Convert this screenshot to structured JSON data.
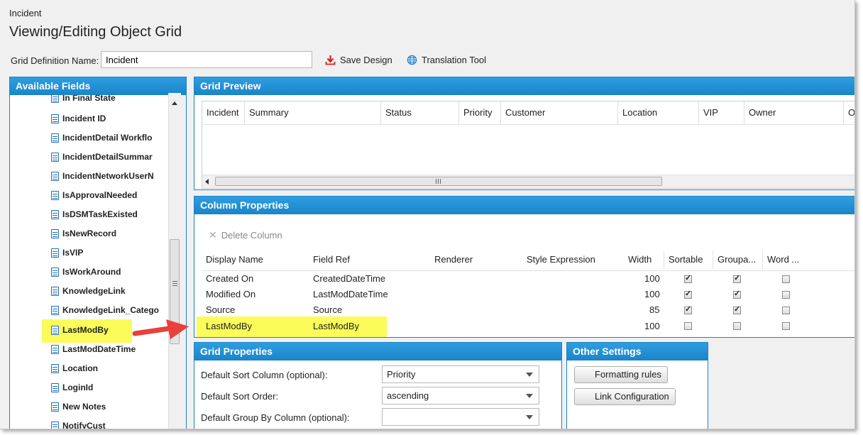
{
  "header": {
    "breadcrumb": "Incident",
    "title": "Viewing/Editing Object Grid",
    "grid_definition_label": "Grid Definition Name:",
    "grid_definition_value": "Incident",
    "save_design": "Save Design",
    "translation_tool": "Translation Tool"
  },
  "available_fields": {
    "title": "Available Fields",
    "items": [
      "In Final State",
      "Incident ID",
      "IncidentDetail Workflo",
      "IncidentDetailSummar",
      "IncidentNetworkUserN",
      "IsApprovalNeeded",
      "IsDSMTaskExisted",
      "IsNewRecord",
      "IsVIP",
      "IsWorkAround",
      "KnowledgeLink",
      "KnowledgeLink_Catego",
      "LastModBy",
      "LastModDateTime",
      "Location",
      "LoginId",
      "New Notes",
      "NotifyCust"
    ]
  },
  "grid_preview": {
    "title": "Grid Preview",
    "columns": [
      "Incident",
      "Summary",
      "Status",
      "Priority",
      "Customer",
      "Location",
      "VIP",
      "Owner",
      "O"
    ]
  },
  "column_properties": {
    "title": "Column Properties",
    "delete_column": "Delete Column",
    "headers": [
      "Display Name",
      "Field Ref",
      "Renderer",
      "Style Expression",
      "Width",
      "Sortable",
      "Groupa...",
      "Word ..."
    ],
    "rows": [
      {
        "display": "Created On",
        "field": "CreatedDateTime",
        "width": "100",
        "sortable": true,
        "groupable": true,
        "wrap": false
      },
      {
        "display": "Modified On",
        "field": "LastModDateTime",
        "width": "100",
        "sortable": true,
        "groupable": true,
        "wrap": false
      },
      {
        "display": "Source",
        "field": "Source",
        "width": "85",
        "sortable": true,
        "groupable": true,
        "wrap": false
      },
      {
        "display": "LastModBy",
        "field": "LastModBy",
        "width": "100",
        "sortable": false,
        "groupable": false,
        "wrap": false
      }
    ]
  },
  "grid_properties": {
    "title": "Grid Properties",
    "sort_column_label": "Default Sort Column (optional):",
    "sort_column_value": "Priority",
    "sort_order_label": "Default Sort Order:",
    "sort_order_value": "ascending",
    "group_by_label": "Default Group By Column (optional):",
    "group_by_value": ""
  },
  "other_settings": {
    "title": "Other Settings",
    "formatting_rules": "Formatting rules",
    "link_configuration": "Link Configuration"
  },
  "colors": {
    "accent_blue": "#1b84c8",
    "highlight_yellow": "#fbfb5a",
    "arrow_red": "#e8413c"
  },
  "icons": {
    "save": "download-arrow-icon",
    "translation": "globe-icon",
    "delete": "x-icon",
    "field": "document-icon"
  }
}
